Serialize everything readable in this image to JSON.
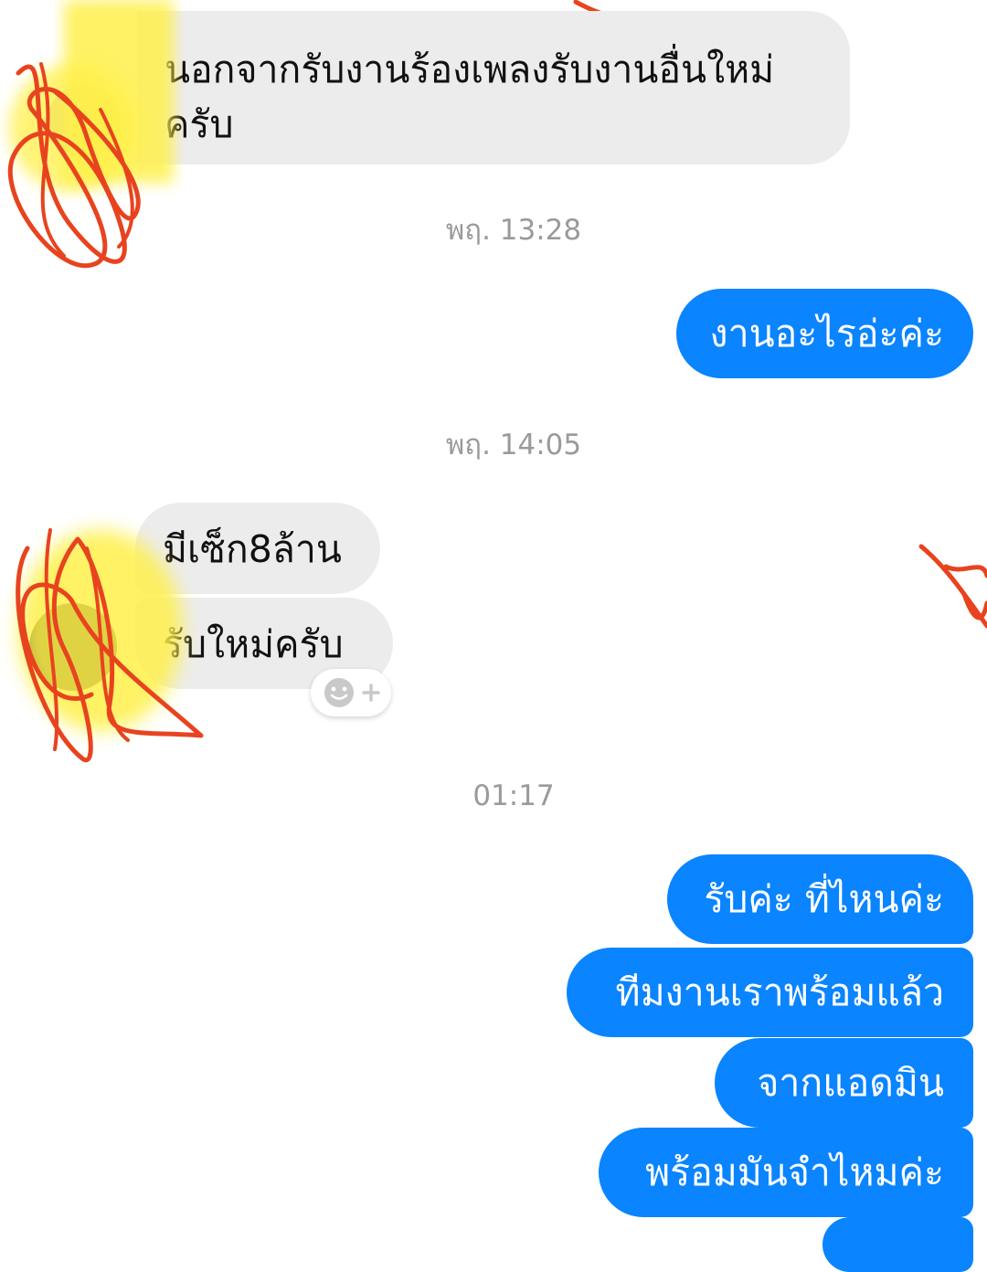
{
  "colors": {
    "incoming_bubble": "#ececec",
    "outgoing_bubble": "#0a84ff",
    "timestamp_text": "#9a9a9a",
    "redaction_scribble": "#e8431f",
    "redaction_highlight": "#fff04a"
  },
  "messages": {
    "incoming_1": "นอกจากรับงานร้องเพลงรับงานอื่นใหม่ครับ",
    "timestamp_1": "พฤ. 13:28",
    "outgoing_1": "งานอะไรอ่ะค่ะ",
    "timestamp_2": "พฤ. 14:05",
    "incoming_2": "มีเซ็ก8ล้าน",
    "incoming_3": "รับใหม่ครับ",
    "timestamp_3": "01:17",
    "outgoing_2": "รับค่ะ ที่ไหนค่ะ",
    "outgoing_3": "ทีมงานเราพร้อมแล้ว",
    "outgoing_4": "จากแอดมิน",
    "outgoing_5": "พร้อมมันจำไหมค่ะ"
  },
  "icons": {
    "reaction": "smiley-add-icon",
    "avatar": "avatar"
  }
}
